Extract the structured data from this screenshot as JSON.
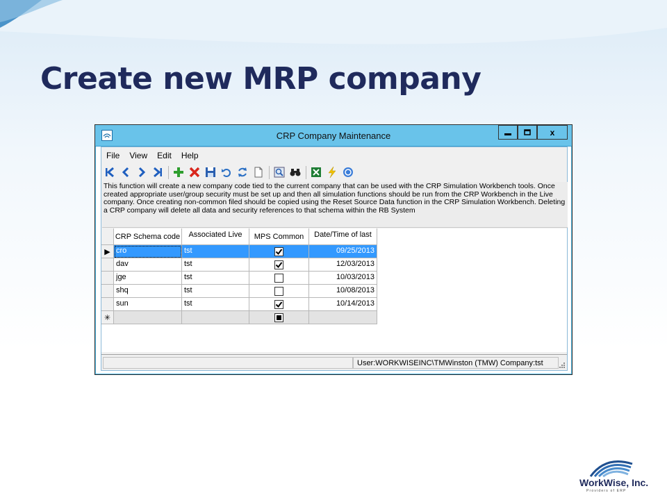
{
  "slide": {
    "title": "Create new MRP company"
  },
  "window": {
    "title": "CRP Company Maintenance",
    "controls": {
      "minimize": "▬",
      "maximize": "□",
      "close": "x"
    }
  },
  "menu": [
    "File",
    "View",
    "Edit",
    "Help"
  ],
  "toolbar": {
    "icons": [
      "first-record-icon",
      "previous-record-icon",
      "next-record-icon",
      "last-record-icon",
      "add-icon",
      "delete-icon",
      "save-icon",
      "undo-icon",
      "refresh-icon",
      "new-document-icon",
      "preview-icon",
      "find-binoculars-icon",
      "excel-export-icon",
      "lightning-icon",
      "help-icon"
    ]
  },
  "description": "This function will create a new company code tied to the current company that can be used with the CRP Simulation Workbench tools. Once created appropriate user/group security must be set up and then all simulation functions should be run from the CRP Workbench in the Live company. Once creating non-common filed should be copied using the Reset Source Data function in the CRP Simulation Workbench. Deleting a CRP company will delete all data and security references to that schema within the RB System",
  "grid": {
    "columns": [
      "CRP Schema code",
      "Associated Live",
      "MPS Common",
      "Date/Time of last"
    ],
    "rows": [
      {
        "schema": "cro",
        "live": "tst",
        "mps_common": true,
        "date": "09/25/2013",
        "selected": true
      },
      {
        "schema": "dav",
        "live": "tst",
        "mps_common": true,
        "date": "12/03/2013",
        "selected": false
      },
      {
        "schema": "jge",
        "live": "tst",
        "mps_common": false,
        "date": "10/03/2013",
        "selected": false
      },
      {
        "schema": "shq",
        "live": "tst",
        "mps_common": false,
        "date": "10/08/2013",
        "selected": false
      },
      {
        "schema": "sun",
        "live": "tst",
        "mps_common": true,
        "date": "10/14/2013",
        "selected": false
      }
    ],
    "current_row_marker": "▶",
    "new_row_marker": "✳"
  },
  "status": {
    "left": "",
    "right": "User:WORKWISEINC\\TMWinston (TMW) Company:tst"
  },
  "logo": {
    "name": "WorkWise, Inc.",
    "tagline": "Providers of ERP"
  },
  "colors": {
    "title": "#1f2a5c",
    "titlebar": "#69c3ea",
    "selection": "#3399ff"
  }
}
